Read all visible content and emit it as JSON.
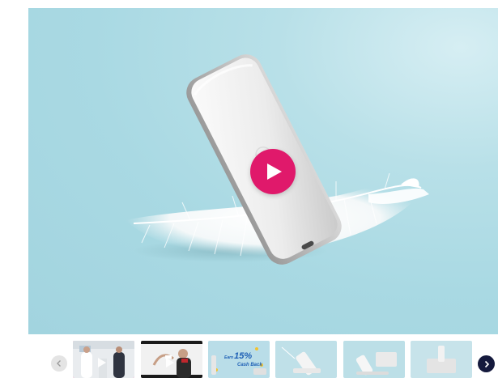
{
  "main_media": {
    "type": "video",
    "play_icon": "play-icon"
  },
  "thumbnails": {
    "prev_icon": "chevron-left-icon",
    "next_icon": "chevron-right-icon",
    "items": [
      {
        "kind": "video",
        "active": true
      },
      {
        "kind": "video",
        "active": false
      },
      {
        "kind": "image",
        "active": false,
        "promo_prefix": "Earn",
        "promo_big": "15%",
        "promo_sub": "Cash Back"
      },
      {
        "kind": "image",
        "active": false
      },
      {
        "kind": "image",
        "active": false
      },
      {
        "kind": "image",
        "active": false
      }
    ]
  },
  "colors": {
    "accent": "#e0196b",
    "background": "#a9d9e3",
    "next_button": "#151a3d"
  }
}
